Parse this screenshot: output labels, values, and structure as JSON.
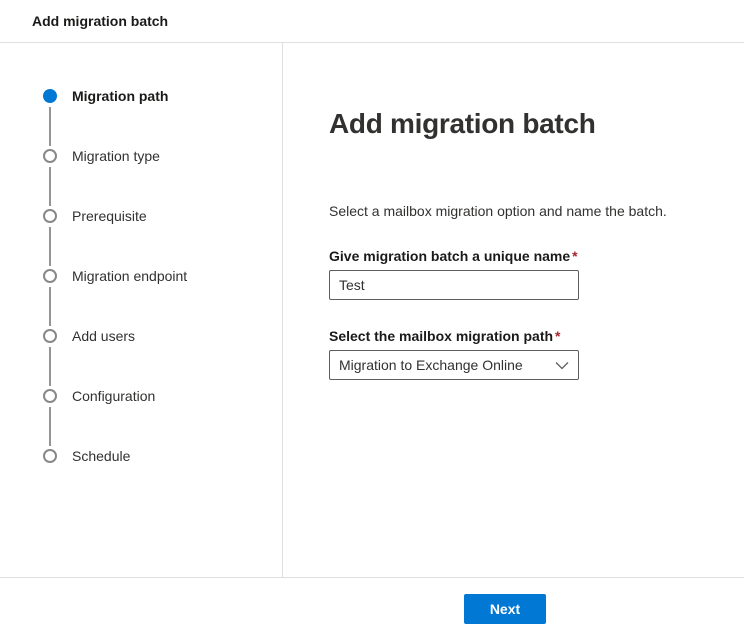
{
  "header": {
    "title": "Add migration batch"
  },
  "stepper": {
    "steps": [
      {
        "label": "Migration path",
        "state": "active"
      },
      {
        "label": "Migration type",
        "state": "upcoming"
      },
      {
        "label": "Prerequisite",
        "state": "upcoming"
      },
      {
        "label": "Migration endpoint",
        "state": "upcoming"
      },
      {
        "label": "Add users",
        "state": "upcoming"
      },
      {
        "label": "Configuration",
        "state": "upcoming"
      },
      {
        "label": "Schedule",
        "state": "upcoming"
      }
    ]
  },
  "main": {
    "title": "Add migration batch",
    "description": "Select a mailbox migration option and name the batch.",
    "name_field": {
      "label": "Give migration batch a unique name",
      "required_marker": "*",
      "value": "Test"
    },
    "path_field": {
      "label": "Select the mailbox migration path",
      "required_marker": "*",
      "selected_option": "Migration to Exchange Online"
    }
  },
  "footer": {
    "next_label": "Next"
  },
  "colors": {
    "accent": "#0078d4",
    "required": "#a4262c",
    "divider": "#e1dfdd",
    "step_inactive": "#8a8886"
  }
}
